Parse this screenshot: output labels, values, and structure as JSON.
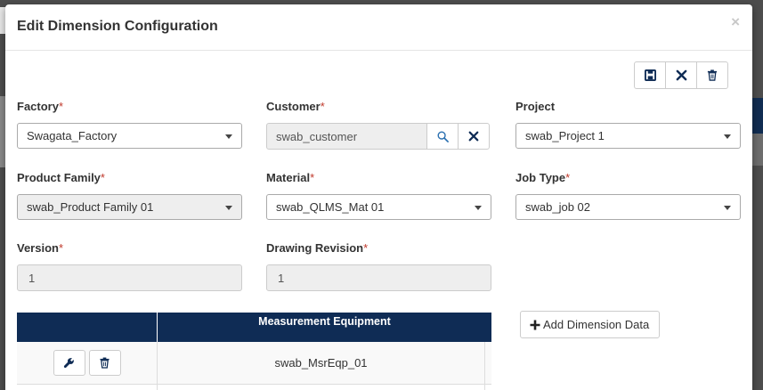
{
  "modal": {
    "title": "Edit Dimension Configuration",
    "close_label": "×"
  },
  "toolbar": {
    "save_icon": "save-icon",
    "cancel_icon": "close-icon",
    "delete_icon": "trash-icon"
  },
  "fields": {
    "factory": {
      "label": "Factory",
      "required": "*",
      "value": "Swagata_Factory"
    },
    "customer": {
      "label": "Customer",
      "required": "*",
      "value": "swab_customer"
    },
    "project": {
      "label": "Project",
      "value": "swab_Project 1"
    },
    "product_family": {
      "label": "Product Family",
      "required": "*",
      "value": "swab_Product Family 01"
    },
    "material": {
      "label": "Material",
      "required": "*",
      "value": "swab_QLMS_Mat 01"
    },
    "job_type": {
      "label": "Job Type",
      "required": "*",
      "value": "swab_job 02"
    },
    "version": {
      "label": "Version",
      "required": "*",
      "value": "1"
    },
    "drawing_revision": {
      "label": "Drawing Revision",
      "required": "*",
      "value": "1"
    }
  },
  "grid": {
    "columns": [
      "",
      "Measurement Equipment"
    ],
    "rows": [
      {
        "equipment": "swab_MsrEqp_01"
      }
    ]
  },
  "add_button": {
    "label": "Add Dimension Data"
  },
  "colors": {
    "header_navy": "#0f2c55",
    "required_red": "#c0392b",
    "disabled_bg": "#eeeeee"
  }
}
